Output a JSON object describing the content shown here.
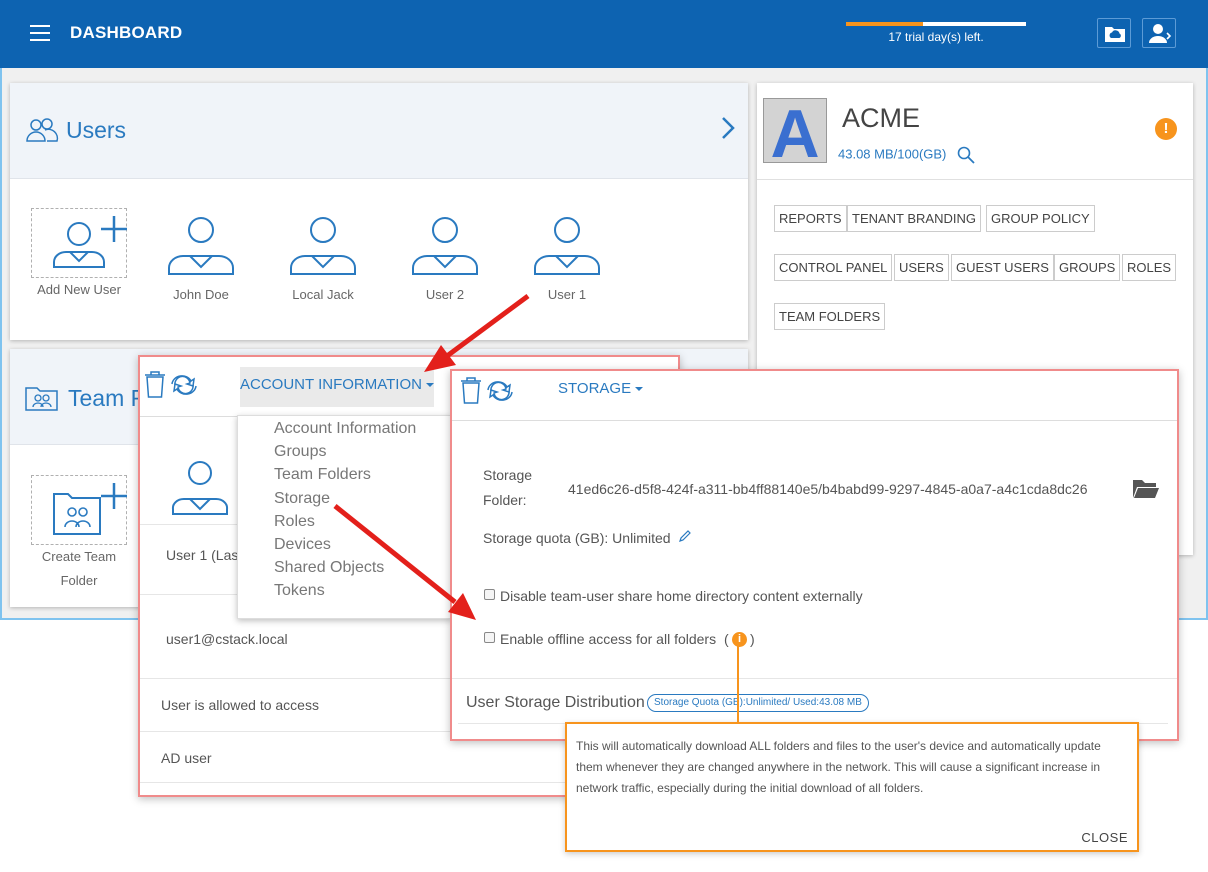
{
  "colors": {
    "brand": "#0d63b1",
    "accent": "#2a7ac0",
    "warning": "#f7941d",
    "highlight_border": "#f08b8b",
    "tooltip_border": "#f7941d",
    "annotation_arrow": "#e3201b"
  },
  "header": {
    "title": "DASHBOARD",
    "trial_text": "17 trial day(s) left.",
    "trial_progress": 0.43,
    "icons": [
      "menu-icon",
      "cloud-folder-icon",
      "user-switch-icon"
    ]
  },
  "users_card": {
    "title": "Users",
    "items": [
      {
        "label": "Add New User"
      },
      {
        "label": "John Doe"
      },
      {
        "label": "Local Jack"
      },
      {
        "label": "User 2"
      },
      {
        "label": "User 1"
      }
    ]
  },
  "team_card": {
    "title": "Team F",
    "items": [
      {
        "label_line1": "Create Team",
        "label_line2": "Folder"
      }
    ]
  },
  "tenant": {
    "logo_letter": "A",
    "name": "ACME",
    "quota": "43.08 MB/100(GB)",
    "warning_symbol": "!",
    "tags": [
      "REPORTS",
      "TENANT BRANDING",
      "GROUP POLICY",
      "CONTROL PANEL",
      "USERS",
      "GUEST USERS",
      "GROUPS",
      "ROLES",
      "TEAM FOLDERS"
    ]
  },
  "account_panel": {
    "dropdown_label": "ACCOUNT INFORMATION",
    "menu": [
      "Account Information",
      "Groups",
      "Team Folders",
      "Storage",
      "Roles",
      "Devices",
      "Shared Objects",
      "Tokens"
    ],
    "rows": {
      "name": "User 1  (Las",
      "email": "user1@cstack.local",
      "access": "User is allowed to access",
      "ad": "AD user"
    }
  },
  "storage_panel": {
    "dropdown_label": "STORAGE",
    "storage_folder_label_1": "Storage",
    "storage_folder_label_2": "Folder:",
    "storage_folder_value": "41ed6c26-d5f8-424f-a311-bb4ff88140e5/b4babd99-9297-4845-a0a7-a4c1cda8dc26",
    "quota_text": "Storage quota (GB): Unlimited",
    "checkbox_1": "Disable team-user share home directory content externally",
    "checkbox_2": "Enable offline access for all folders",
    "paren_open": "(",
    "paren_close": ")",
    "info_symbol": "i",
    "distribution_title": "User Storage Distribution",
    "distribution_badge": "Storage Quota (GB):Unlimited/ Used:43.08 MB"
  },
  "tooltip": {
    "text": "This will automatically download ALL folders and files to the user's device and automatically update them whenever they are changed anywhere in the network. This will cause a significant increase in network traffic, especially during the initial download of all folders.",
    "close": "CLOSE"
  }
}
